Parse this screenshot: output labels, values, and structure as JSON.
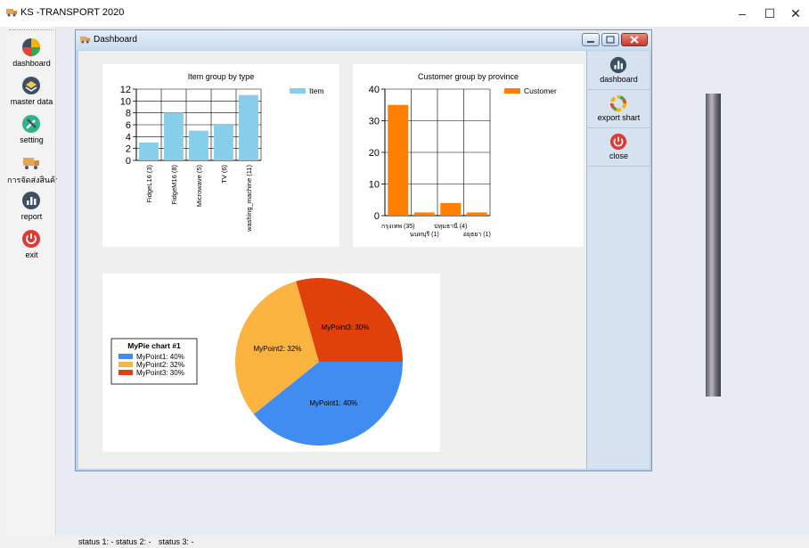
{
  "app": {
    "title": "KS -TRANSPORT 2020",
    "controls": {
      "minimize": "–",
      "maximize": "☐",
      "close": "✕"
    }
  },
  "sidebar": {
    "items": [
      {
        "label": "dashboard",
        "icon": "dashboard-icon"
      },
      {
        "label": "master data",
        "icon": "database-icon"
      },
      {
        "label": "setting",
        "icon": "tools-icon"
      },
      {
        "label": "การจัดส่งสินค้า",
        "icon": "delivery-truck-icon"
      },
      {
        "label": "report",
        "icon": "report-icon"
      },
      {
        "label": "exit",
        "icon": "power-icon"
      }
    ]
  },
  "window": {
    "title": "Dashboard",
    "right_panel": [
      {
        "label": "dashboard",
        "icon": "dashboard-icon"
      },
      {
        "label": "export shart",
        "icon": "export-icon"
      },
      {
        "label": "close",
        "icon": "power-icon"
      }
    ]
  },
  "status": {
    "s1": "status 1:  -",
    "s2": "status 2:  -",
    "s3": "status 3:  -"
  },
  "colors": {
    "bar_blue": "#87ceeb",
    "bar_orange": "#ff7f00",
    "pie_blue": "#418cf0",
    "pie_yellow": "#fcb441",
    "pie_red": "#e0400a",
    "exit_red": "#e03a35"
  },
  "chart_data": [
    {
      "type": "bar",
      "title": "Item group by type",
      "categories": [
        "FidgeL16 (3)",
        "FidgeM16 (8)",
        "Microwave (5)",
        "TV (6)",
        "washing_machine (11)"
      ],
      "series": [
        {
          "name": "Item",
          "values": [
            3,
            8,
            5,
            6,
            11
          ]
        }
      ],
      "ylim": [
        0,
        12
      ],
      "yticks": [
        "0",
        "2",
        "4",
        "6",
        "8",
        "10",
        "12"
      ],
      "grid": true,
      "legend": "top-right"
    },
    {
      "type": "bar",
      "title": "Customer group by province",
      "categories": [
        "กรุงเทพ (35)",
        "นนทบุรี (1)",
        "ปทุมธานี (4)",
        "อยุธยา (1)"
      ],
      "series": [
        {
          "name": "Customer",
          "values": [
            35,
            1,
            4,
            1
          ]
        }
      ],
      "ylim": [
        0,
        40
      ],
      "yticks": [
        "0",
        "10",
        "20",
        "30",
        "40"
      ],
      "grid": true,
      "legend": "top-right"
    },
    {
      "type": "pie",
      "title": "MyPie chart #1",
      "categories": [
        "MyPoint1",
        "MyPoint2",
        "MyPoint3"
      ],
      "values": [
        40,
        32,
        30
      ],
      "labels": [
        "MyPoint1: 40%",
        "MyPoint2: 32%",
        "MyPoint3: 30%"
      ],
      "legend": "left"
    }
  ]
}
